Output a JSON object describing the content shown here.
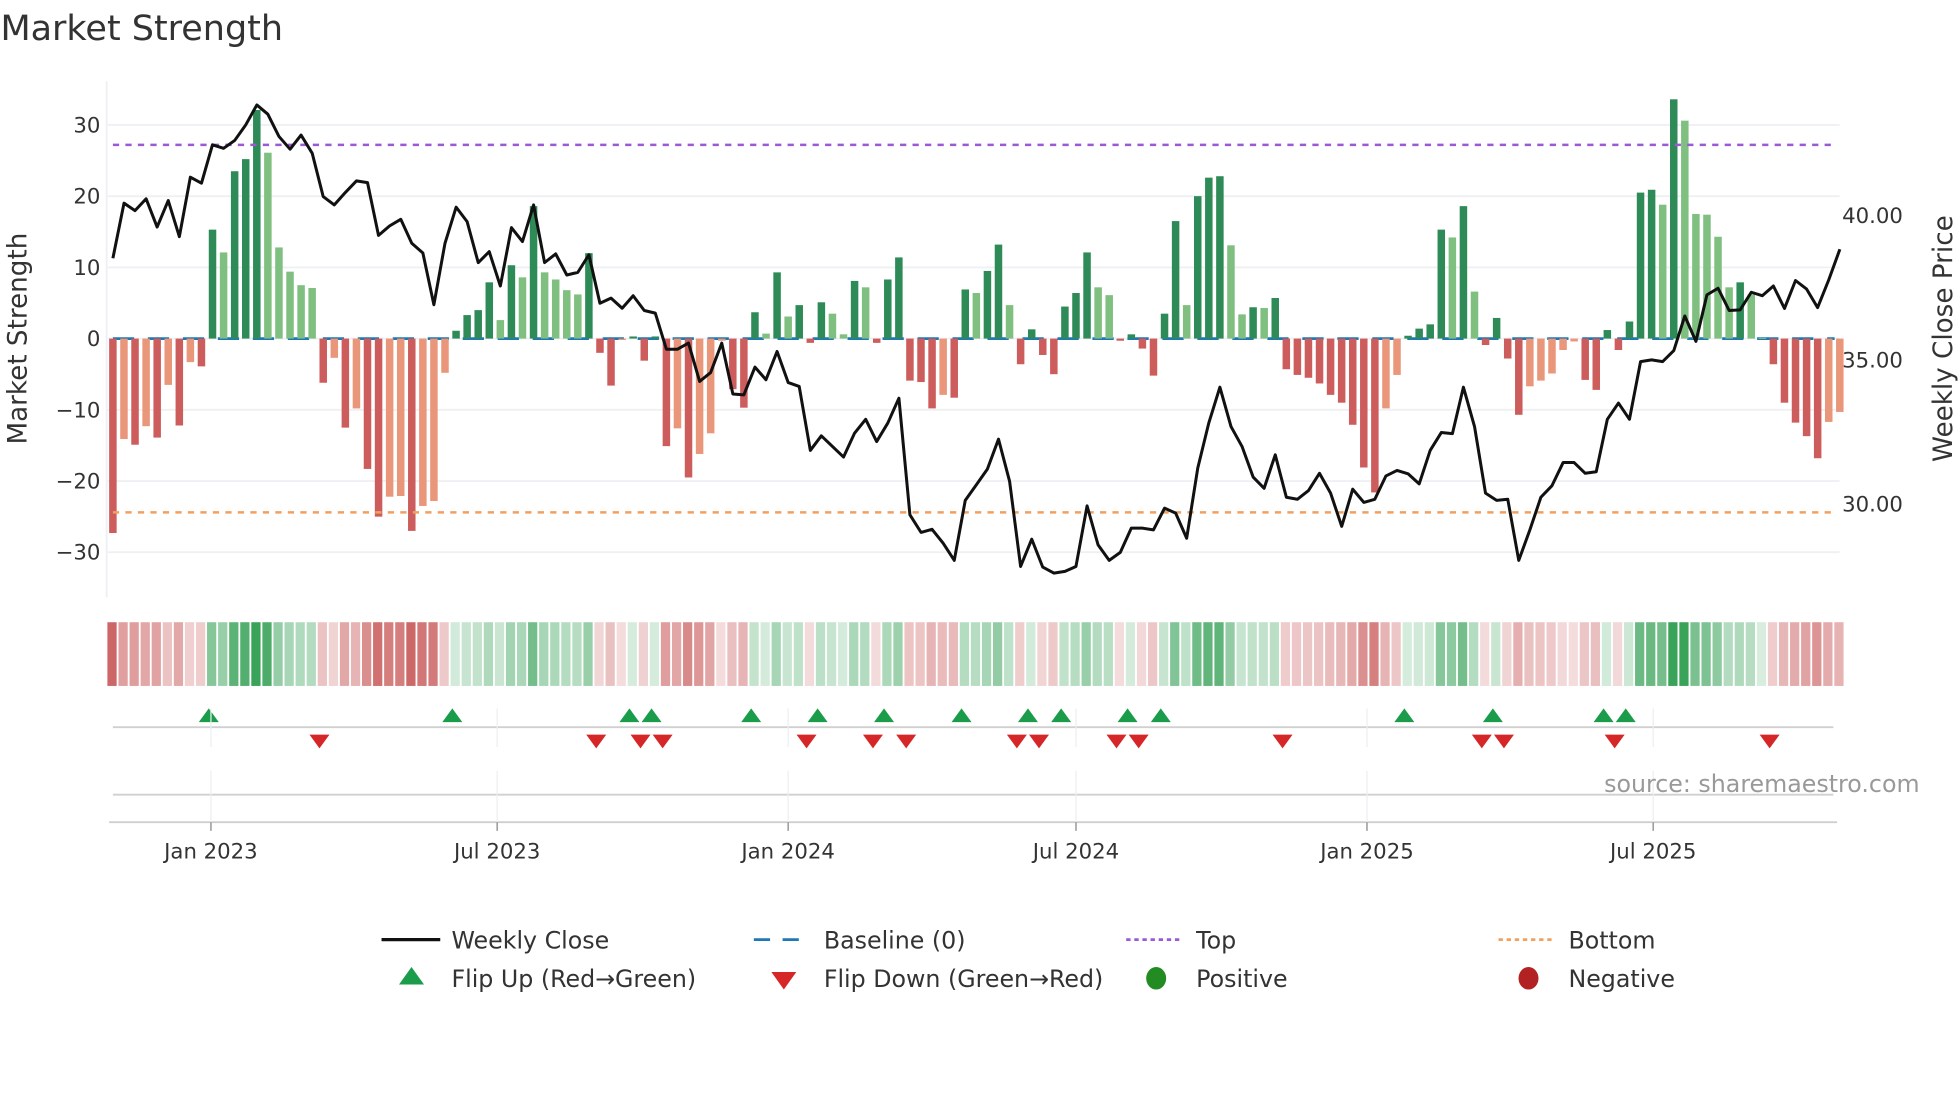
{
  "chart_data": {
    "type": "bar+line",
    "title": "Market Strength",
    "ylabel": "Market Strength",
    "y2label": "Weekly Close Price",
    "start_date": "2022-10-31",
    "frequency": "weekly",
    "ylim": [
      -36,
      36
    ],
    "y2lim": [
      26.85,
      44.7
    ],
    "yticks": [
      -30,
      -20,
      -10,
      0,
      10,
      20,
      30
    ],
    "ytick_labels": [
      "−30",
      "−20",
      "−10",
      "0",
      "10",
      "20",
      "30"
    ],
    "y2ticks": [
      30,
      35,
      40
    ],
    "y2tick_labels": [
      "30.00",
      "35.00",
      "40.00"
    ],
    "xticks": [
      {
        "date": "2023-01-01",
        "label": "Jan 2023"
      },
      {
        "date": "2023-07-01",
        "label": "Jul 2023"
      },
      {
        "date": "2024-01-01",
        "label": "Jan 2024"
      },
      {
        "date": "2024-07-01",
        "label": "Jul 2024"
      },
      {
        "date": "2025-01-01",
        "label": "Jan 2025"
      },
      {
        "date": "2025-07-01",
        "label": "Jul 2025"
      }
    ],
    "top_level": 27.2,
    "bottom_level": -24.4,
    "baseline": 0,
    "strength": [
      -27.3,
      -14.1,
      -14.9,
      -12.3,
      -13.9,
      -6.5,
      -12.2,
      -3.3,
      -3.9,
      15.3,
      12.1,
      23.5,
      25.2,
      32.1,
      26.1,
      12.8,
      9.4,
      7.5,
      7.1,
      -6.2,
      -2.7,
      -12.5,
      -9.8,
      -18.3,
      -25.0,
      -22.2,
      -22.1,
      -27.0,
      -23.5,
      -22.8,
      -4.8,
      1.1,
      3.3,
      4.0,
      7.9,
      2.6,
      10.3,
      8.6,
      18.6,
      9.3,
      8.3,
      6.8,
      6.2,
      12.0,
      -2.0,
      -6.6,
      -0.2,
      0.3,
      -3.1,
      0.3,
      -15.1,
      -12.6,
      -19.5,
      -16.2,
      -13.3,
      -0.3,
      -7.1,
      -9.7,
      3.7,
      0.7,
      9.3,
      3.1,
      4.7,
      -0.6,
      5.1,
      3.5,
      0.6,
      8.1,
      7.2,
      -0.6,
      8.3,
      11.4,
      -5.9,
      -6.1,
      -9.8,
      -7.9,
      -8.3,
      6.9,
      6.4,
      9.5,
      13.2,
      4.7,
      -3.6,
      1.3,
      -2.3,
      -5.0,
      4.5,
      6.4,
      12.1,
      7.2,
      6.1,
      -0.3,
      0.6,
      -1.4,
      -5.2,
      3.5,
      16.5,
      4.7,
      20.0,
      22.6,
      22.8,
      13.1,
      3.4,
      4.4,
      4.3,
      5.7,
      -4.3,
      -5.1,
      -5.5,
      -6.3,
      -7.9,
      -9.0,
      -12.1,
      -18.1,
      -21.6,
      -9.8,
      -5.1,
      0.4,
      1.4,
      2.0,
      15.3,
      14.2,
      18.6,
      6.6,
      -0.9,
      2.9,
      -2.8,
      -10.7,
      -6.7,
      -5.9,
      -4.9,
      -1.6,
      -0.4,
      -5.8,
      -7.2,
      1.2,
      -1.6,
      2.4,
      20.5,
      20.9,
      18.8,
      33.6,
      30.6,
      17.5,
      17.4,
      14.3,
      7.2,
      7.9,
      6.2,
      0.1,
      -3.6,
      -9.0,
      -11.8,
      -13.7,
      -16.8,
      -11.7,
      -10.3
    ],
    "close": [
      38.52,
      40.43,
      40.17,
      40.58,
      39.6,
      40.52,
      39.27,
      41.33,
      41.12,
      42.45,
      42.33,
      42.6,
      43.14,
      43.83,
      43.51,
      42.74,
      42.3,
      42.79,
      42.16,
      40.66,
      40.37,
      40.8,
      41.2,
      41.14,
      39.31,
      39.64,
      39.87,
      39.04,
      38.7,
      36.91,
      39.04,
      40.29,
      39.79,
      38.37,
      38.75,
      37.56,
      39.58,
      39.1,
      40.37,
      38.37,
      38.67,
      37.94,
      38.03,
      38.64,
      36.96,
      37.14,
      36.79,
      37.22,
      36.71,
      36.62,
      35.37,
      35.37,
      35.58,
      34.25,
      34.56,
      35.58,
      33.82,
      33.79,
      34.75,
      34.31,
      35.29,
      34.21,
      34.08,
      31.86,
      32.37,
      32.0,
      31.63,
      32.46,
      32.94,
      32.17,
      32.81,
      33.67,
      29.63,
      29.02,
      29.13,
      28.65,
      28.05,
      30.13,
      30.67,
      31.21,
      32.25,
      30.79,
      27.84,
      28.79,
      27.82,
      27.61,
      27.67,
      27.84,
      29.94,
      28.59,
      28.05,
      28.33,
      29.17,
      29.17,
      29.11,
      29.86,
      29.69,
      28.82,
      31.25,
      32.81,
      34.05,
      32.69,
      32.0,
      30.94,
      30.55,
      31.71,
      30.24,
      30.17,
      30.47,
      31.07,
      30.38,
      29.23,
      30.52,
      30.06,
      30.17,
      30.98,
      31.17,
      31.05,
      30.7,
      31.86,
      32.48,
      32.44,
      34.05,
      32.69,
      30.38,
      30.13,
      30.17,
      28.05,
      29.11,
      30.24,
      30.64,
      31.44,
      31.44,
      31.07,
      31.12,
      32.94,
      33.5,
      32.94,
      34.94,
      35.0,
      34.94,
      35.32,
      36.52,
      35.64,
      37.25,
      37.48,
      36.71,
      36.73,
      37.34,
      37.22,
      37.56,
      36.78,
      37.75,
      37.45,
      36.81,
      37.77,
      38.83
    ],
    "legend": {
      "placement": "bottom-center",
      "items": [
        {
          "label": "Weekly Close",
          "symbol": "line"
        },
        {
          "label": "Baseline (0)",
          "symbol": "dash"
        },
        {
          "label": "Top",
          "symbol": "dot"
        },
        {
          "label": "Bottom",
          "symbol": "dot"
        },
        {
          "label": "Flip Up (Red→Green)",
          "symbol": "triangle-up"
        },
        {
          "label": "Flip Down (Green→Red)",
          "symbol": "triangle-down"
        },
        {
          "label": "Positive",
          "symbol": "circle"
        },
        {
          "label": "Negative",
          "symbol": "circle"
        }
      ]
    },
    "source": "source: sharemaestro.com",
    "colors": {
      "pos_strong": "#2e8b57",
      "pos_weak": "#7fbf7f",
      "neg_strong": "#cd5c5c",
      "neg_weak": "#e9967a",
      "close": "#111111",
      "baseline": "#1f77b4",
      "top": "#9b59d6",
      "bottom": "#f0a060",
      "flip_up": "#1a9c4a",
      "flip_down": "#d62728",
      "positive": "#228b22",
      "negative": "#b22222",
      "strip_pos": "#3aa35a",
      "strip_neg": "#c95b5b"
    }
  }
}
